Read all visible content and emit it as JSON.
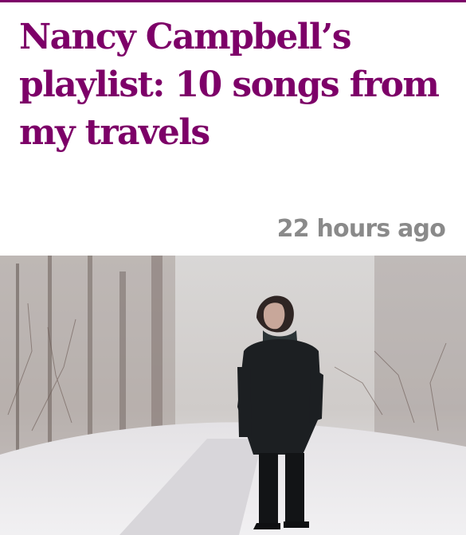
{
  "article": {
    "headline": "Nancy Campbell’s playlist: 10 songs from my travels",
    "timestamp": "22 hours ago"
  },
  "colors": {
    "accent": "#7d0068",
    "meta": "#8a8a8a"
  }
}
